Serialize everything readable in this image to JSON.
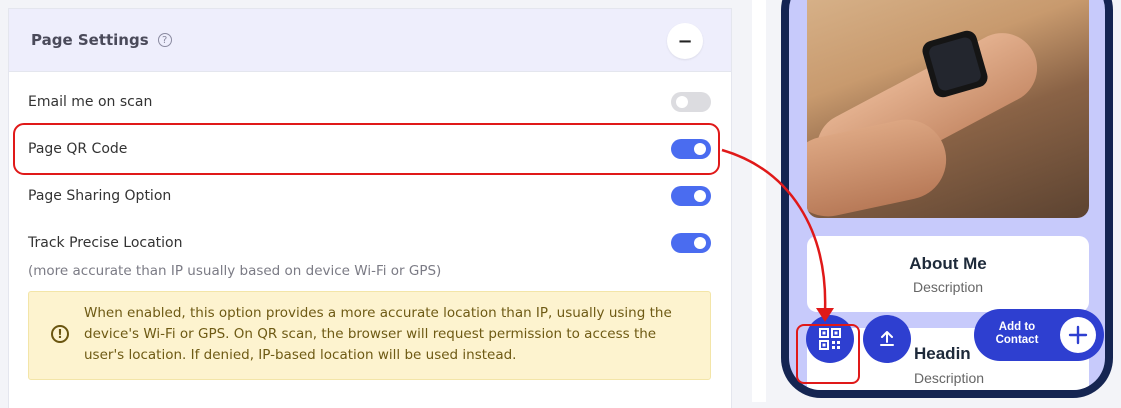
{
  "settings": {
    "title": "Page Settings",
    "collapse_symbol": "−",
    "rows": [
      {
        "label": "Email me on scan",
        "on": false
      },
      {
        "label": "Page QR Code",
        "on": true
      },
      {
        "label": "Page Sharing Option",
        "on": true
      },
      {
        "label": "Track Precise Location",
        "on": true
      }
    ],
    "location_note": "(more accurate than IP usually based on device Wi-Fi or GPS)",
    "info_text": "When enabled, this option provides a more accurate location than IP, usually using the device's Wi-Fi or GPS. On QR scan, the browser will request permission to access the user's location. If denied, IP-based location will be used instead."
  },
  "preview": {
    "about_card": {
      "title": "About Me",
      "description": "Description"
    },
    "heading_card": {
      "title": "Headin",
      "description": "Description"
    },
    "add_contact_label": "Add to Contact"
  },
  "colors": {
    "toggle_on": "#4a6cf0",
    "annotation_red": "#e01919",
    "phone_fab": "#2e3fd0"
  }
}
